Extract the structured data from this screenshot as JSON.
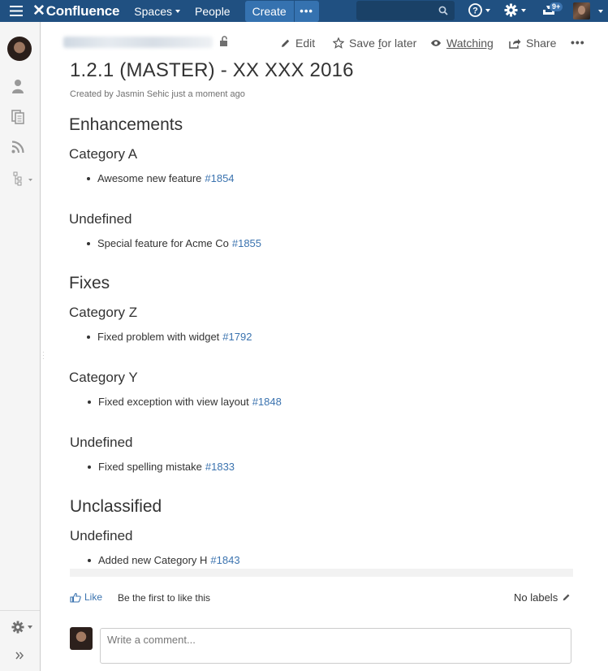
{
  "header": {
    "app_name": "Confluence",
    "nav": {
      "spaces": "Spaces",
      "people": "People"
    },
    "create_label": "Create",
    "more_label": "•••",
    "notifications_count": "9+"
  },
  "page": {
    "actions": {
      "edit": "Edit",
      "save_for_later_pre": "Save ",
      "save_for_later_ul": "f",
      "save_for_later_post": "or later",
      "watching": "Watching",
      "share": "Share",
      "more": "•••"
    },
    "title": "1.2.1 (MASTER) - XX XXX 2016",
    "byline_prefix": "Created by ",
    "author": "Jasmin Sehic",
    "byline_suffix": " just a moment ago"
  },
  "sections": {
    "enhancements": {
      "title": "Enhancements",
      "cat_a": {
        "title": "Category A",
        "item": "Awesome new feature",
        "link": "#1854"
      },
      "undefined": {
        "title": "Undefined",
        "item": "Special feature for Acme Co",
        "link": "#1855"
      }
    },
    "fixes": {
      "title": "Fixes",
      "cat_z": {
        "title": "Category Z",
        "item": "Fixed problem with widget",
        "link": "#1792"
      },
      "cat_y": {
        "title": "Category Y",
        "item": "Fixed exception with view layout",
        "link": "#1848"
      },
      "undefined": {
        "title": "Undefined",
        "item": "Fixed spelling mistake",
        "link": "#1833"
      }
    },
    "unclassified": {
      "title": "Unclassified",
      "undefined": {
        "title": "Undefined",
        "item": "Added new Category H",
        "link": "#1843"
      }
    }
  },
  "footer": {
    "like": "Like",
    "first_like": "Be the first to like this",
    "no_labels": "No labels",
    "comment_placeholder": "Write a comment..."
  },
  "colors": {
    "header_bg": "#205081",
    "link": "#3b73af"
  }
}
